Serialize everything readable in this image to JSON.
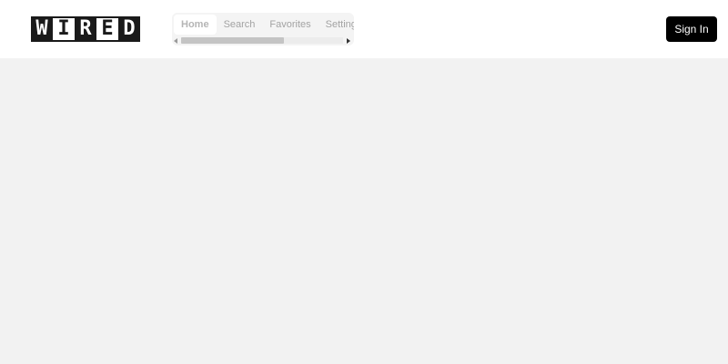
{
  "brand": {
    "logo_text": "WIRED",
    "letters": [
      "W",
      "I",
      "R",
      "E",
      "D"
    ]
  },
  "nav": {
    "tabs": [
      {
        "label": "Home",
        "active": true
      },
      {
        "label": "Search",
        "active": false
      },
      {
        "label": "Favorites",
        "active": false
      },
      {
        "label": "Settings",
        "active": false
      }
    ],
    "scroll_position": 0.6
  },
  "header": {
    "signin_label": "Sign In"
  },
  "colors": {
    "header_bg": "#ffffff",
    "page_bg": "#f2f2f2",
    "button_bg": "#000000",
    "button_text": "#ffffff",
    "logo_dark": "#1a1a1a"
  }
}
